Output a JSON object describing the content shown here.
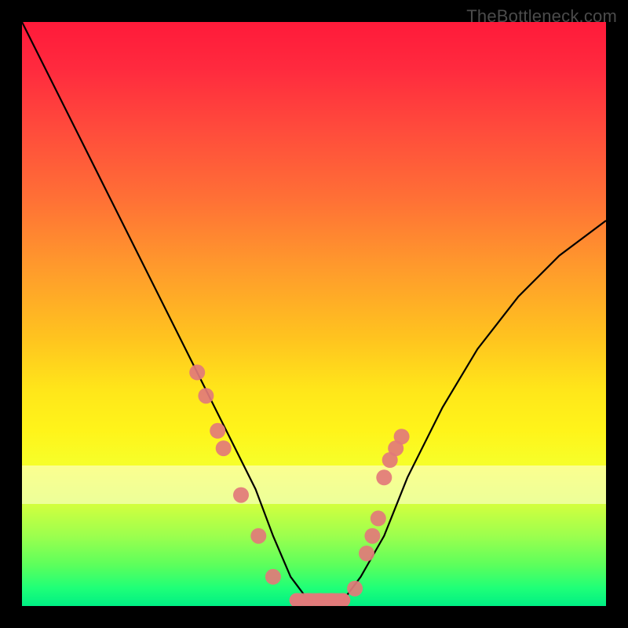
{
  "watermark": "TheBottleneck.com",
  "chart_data": {
    "type": "line",
    "title": "",
    "xlabel": "",
    "ylabel": "",
    "xlim": [
      0,
      100
    ],
    "ylim": [
      0,
      100
    ],
    "grid": false,
    "legend_position": "none",
    "background": "rainbow-gradient (red→orange→yellow→green, top→bottom)",
    "series": [
      {
        "name": "bottleneck-curve",
        "x": [
          0,
          5,
          10,
          15,
          20,
          25,
          30,
          35,
          40,
          43,
          46,
          49,
          52,
          55,
          58,
          62,
          66,
          72,
          78,
          85,
          92,
          100
        ],
        "y": [
          100,
          90,
          80,
          70,
          60,
          50,
          40,
          30,
          20,
          12,
          5,
          1,
          1,
          1,
          5,
          12,
          22,
          34,
          44,
          53,
          60,
          66
        ],
        "stroke": "#000000"
      }
    ],
    "markers": {
      "name": "data-points",
      "color": "#e27a7a",
      "points": [
        {
          "x": 30,
          "y": 40
        },
        {
          "x": 31.5,
          "y": 36
        },
        {
          "x": 33.5,
          "y": 30
        },
        {
          "x": 34.5,
          "y": 27
        },
        {
          "x": 37.5,
          "y": 19
        },
        {
          "x": 40.5,
          "y": 12
        },
        {
          "x": 43,
          "y": 5
        },
        {
          "x": 47,
          "y": 1
        },
        {
          "x": 49,
          "y": 1
        },
        {
          "x": 51,
          "y": 1
        },
        {
          "x": 53,
          "y": 1
        },
        {
          "x": 55,
          "y": 1
        },
        {
          "x": 57,
          "y": 3
        },
        {
          "x": 59,
          "y": 9
        },
        {
          "x": 60,
          "y": 12
        },
        {
          "x": 61,
          "y": 15
        },
        {
          "x": 62,
          "y": 22
        },
        {
          "x": 63,
          "y": 25
        },
        {
          "x": 64,
          "y": 27
        },
        {
          "x": 65,
          "y": 29
        }
      ]
    }
  }
}
